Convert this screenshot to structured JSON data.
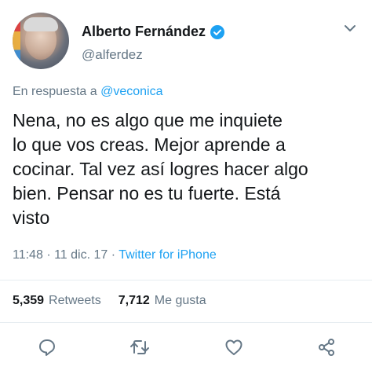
{
  "user": {
    "display_name": "Alberto Fernández",
    "handle": "@alferdez",
    "verified": true
  },
  "reply_to": {
    "prefix": "En respuesta a",
    "handle": "@veconica"
  },
  "tweet": {
    "text": "Nena, no es algo que me inquiete\nlo que vos creas. Mejor aprende a\ncocinar. Tal vez así logres hacer algo\nbien. Pensar no es tu fuerte. Está\nvisto",
    "time": "11:48",
    "separator": "·",
    "date": "11 dic. 17",
    "source": "Twitter for iPhone"
  },
  "stats": {
    "retweets_count": "5,359",
    "retweets_label": "Retweets",
    "likes_count": "7,712",
    "likes_label": "Me gusta"
  },
  "colors": {
    "accent": "#1da1f2",
    "secondary_text": "#657786",
    "primary_text": "#14171a",
    "divider": "#e6ecf0"
  },
  "icons": [
    "verified-badge-icon",
    "chevron-down-icon",
    "reply-icon",
    "retweet-icon",
    "like-icon",
    "share-icon"
  ]
}
